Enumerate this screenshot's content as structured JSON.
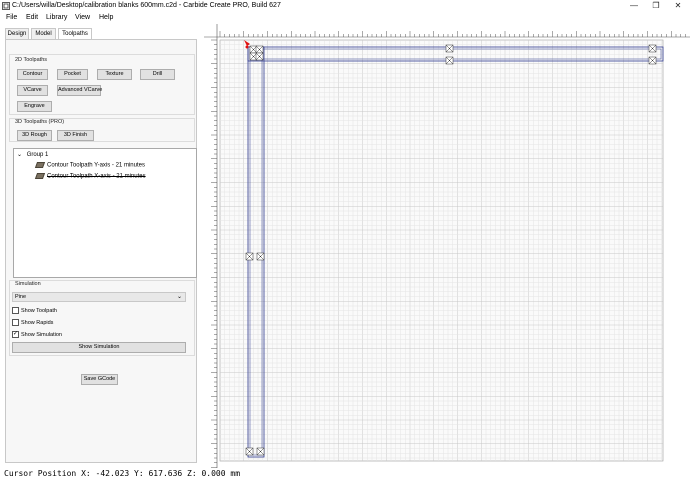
{
  "window": {
    "title": "C:/Users/willa/Desktop/calibration blanks 600mm.c2d - Carbide Create PRO, Build 627",
    "minimize_glyph": "—",
    "maximize_glyph": "❐",
    "close_glyph": "✕"
  },
  "menu": {
    "file": "File",
    "edit": "Edit",
    "library": "Library",
    "view": "View",
    "help": "Help"
  },
  "tabs": {
    "design": "Design",
    "model": "Model",
    "toolpaths": "Toolpaths",
    "active": "Toolpaths"
  },
  "toolpaths_2d": {
    "title": "2D Toolpaths",
    "contour": "Contour",
    "pocket": "Pocket",
    "texture": "Texture",
    "drill": "Drill",
    "vcarve": "VCarve",
    "advanced_vcarve": "Advanced VCarve",
    "engrave": "Engrave"
  },
  "toolpaths_3d": {
    "title": "3D Toolpaths (PRO)",
    "rough": "3D Rough",
    "finish": "3D Finish"
  },
  "tree": {
    "expander": "⌄",
    "group": "Group 1",
    "items": [
      {
        "label": "Contour Toolpath Y-axis - 21 minutes",
        "disabled": false
      },
      {
        "label": "Contour Toolpath X-axis - 21 minutes",
        "disabled": true
      }
    ]
  },
  "simulation": {
    "title": "Simulation",
    "material": "Pine",
    "show_toolpath": {
      "label": "Show Toolpath",
      "checked": false
    },
    "show_rapids": {
      "label": "Show Rapids",
      "checked": false
    },
    "show_simulation": {
      "label": "Show Simulation",
      "checked": true
    },
    "button": "Show Simulation",
    "check_glyph": "✓"
  },
  "save_gcode": "Save GCode",
  "status": {
    "text": "Cursor Position X: -42.023 Y: 617.636 Z: 0.000 mm"
  },
  "colors": {
    "grid_minor": "#e4e4e4",
    "grid_major": "#c8c8c8",
    "outline": "#2f3a8f",
    "origin": "#e01010",
    "ruler": "#555555"
  },
  "icons": {
    "app": "carbide-create-icon",
    "origin": "origin-marker-icon",
    "tab": "x-box-tab-icon"
  }
}
